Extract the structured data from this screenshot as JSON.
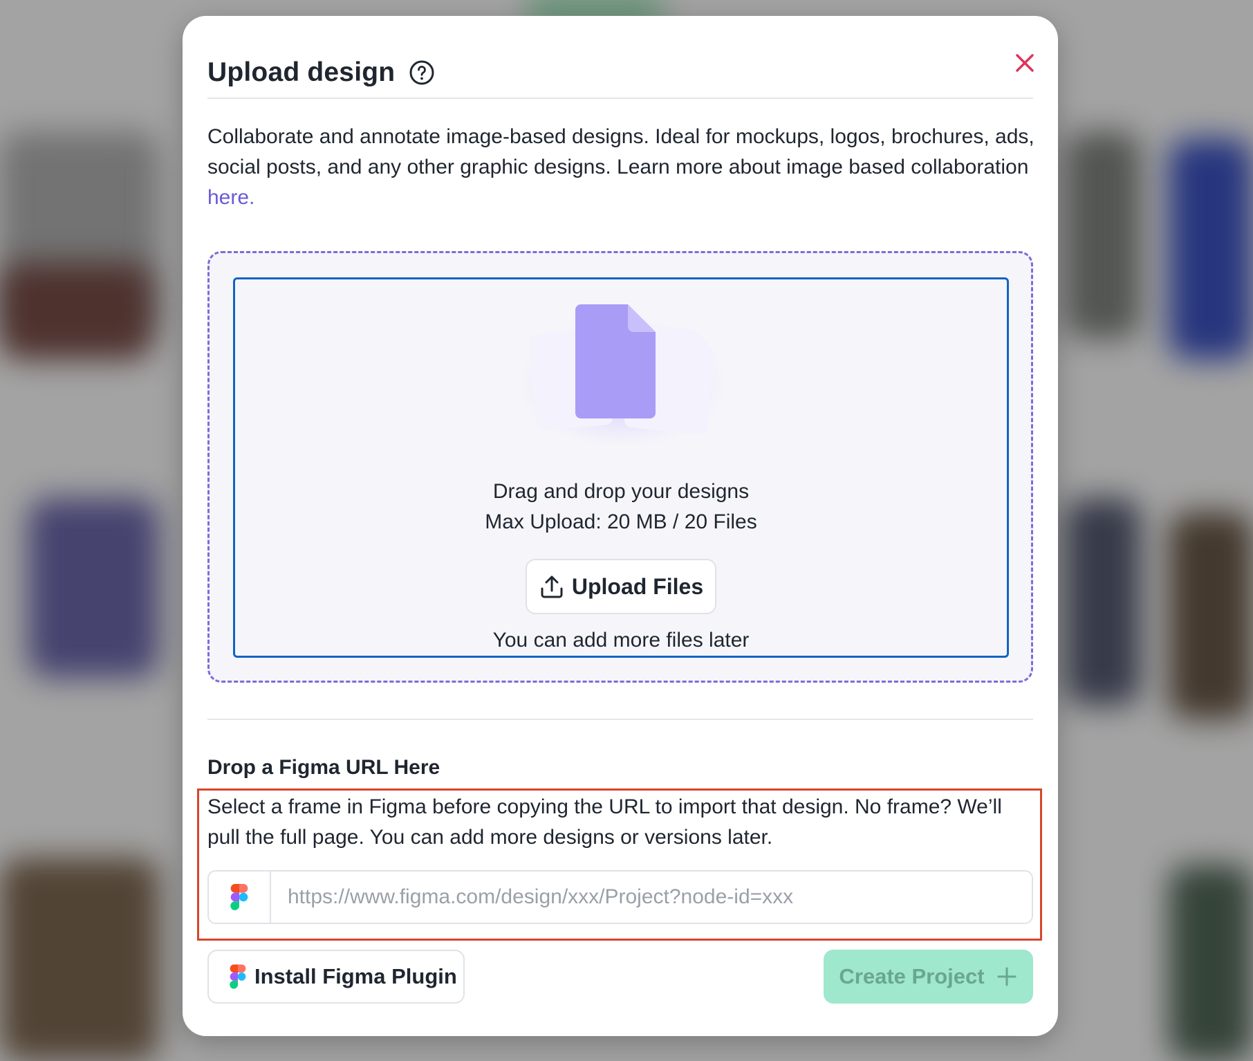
{
  "modal": {
    "title": "Upload design",
    "description": "Collaborate and annotate image-based designs. Ideal for mockups, logos, brochures, ads, social posts, and any other graphic designs. Learn more about image based collaboration ",
    "learn_more_link": "here."
  },
  "dropzone": {
    "title": "Drag and drop your designs",
    "limit": "Max Upload: 20 MB / 20 Files",
    "upload_button": "Upload Files",
    "later_note": "You can add more files later"
  },
  "figma": {
    "heading": "Drop a Figma URL Here",
    "help_text": "Select a frame in Figma before copying the URL to import that design. No frame? We’ll pull the full page. You can add more designs or versions later.",
    "url_value": "",
    "url_placeholder": "https://www.figma.com/design/xxx/Project?node-id=xxx"
  },
  "footer": {
    "plugin_button": "Install Figma Plugin",
    "create_button": "Create Project"
  },
  "icons": {
    "help": "question-circle-icon",
    "close": "close-icon",
    "upload": "upload-icon",
    "figma": "figma-logo-icon",
    "plus": "plus-icon"
  },
  "colors": {
    "close": "#e0345a",
    "link": "#6a5ad9",
    "dropzone_dash": "#7f6ad8",
    "dropzone_focus": "#1264c4",
    "highlight": "#d8452c",
    "create_button_bg": "#9fe7cd",
    "create_button_text": "#6aa790"
  }
}
